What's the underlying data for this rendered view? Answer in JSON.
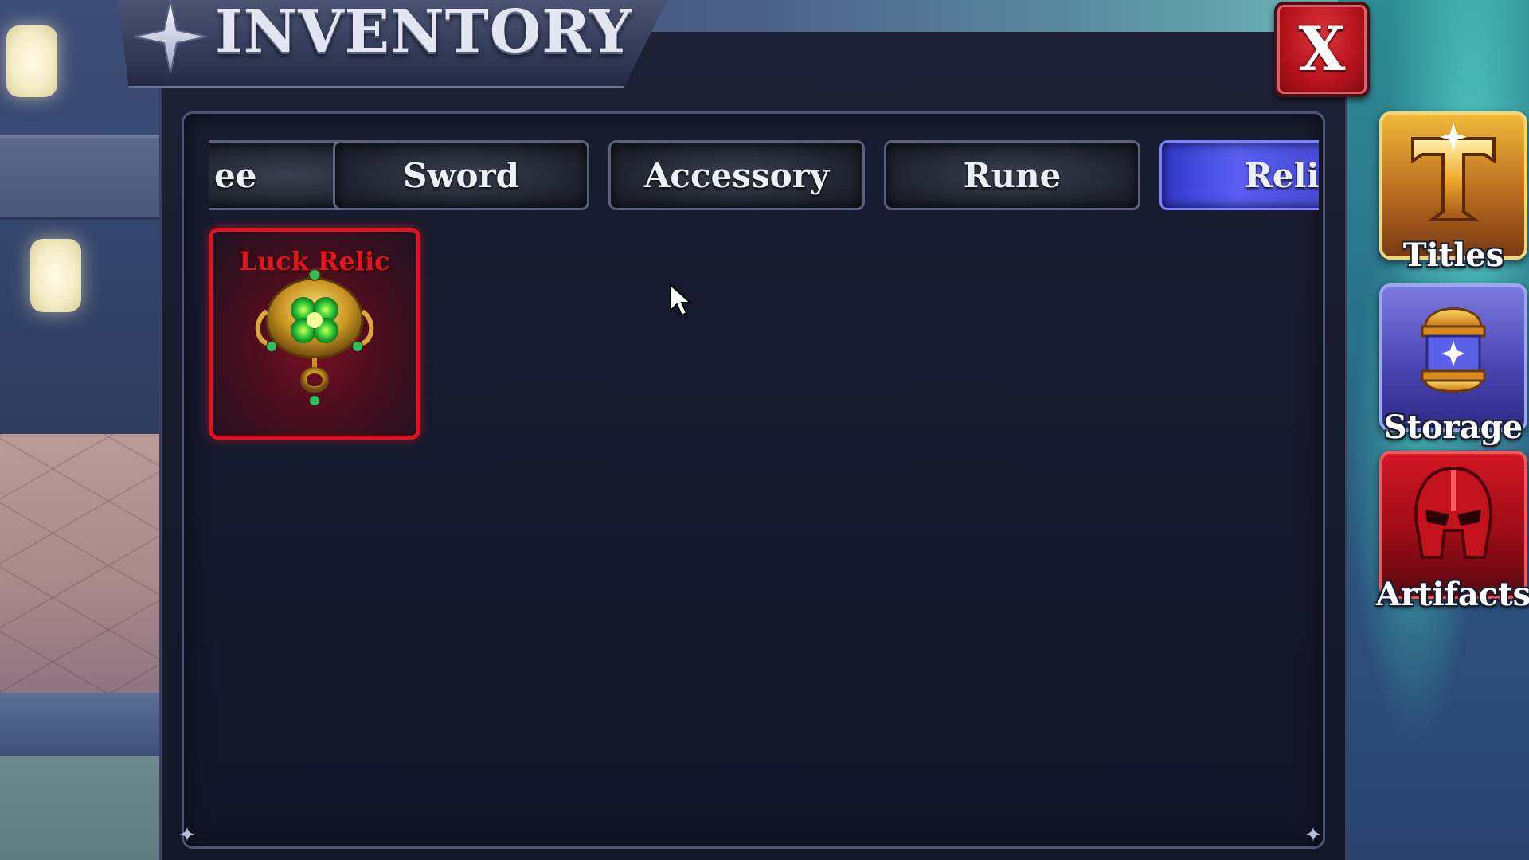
{
  "header": {
    "title": "INVENTORY",
    "close_label": "X"
  },
  "tabs": [
    {
      "label": "ee",
      "state": "partial"
    },
    {
      "label": "Sword",
      "state": "normal"
    },
    {
      "label": "Accessory",
      "state": "normal"
    },
    {
      "label": "Rune",
      "state": "normal"
    },
    {
      "label": "Relic",
      "state": "active"
    }
  ],
  "items": [
    {
      "name": "Luck Relic",
      "icon": "clover-amulet-icon",
      "rarity_color": "#e0121e"
    }
  ],
  "side_menu": [
    {
      "label": "Titles",
      "icon": "title-letter-t-icon"
    },
    {
      "label": "Storage",
      "icon": "storage-capsule-icon"
    },
    {
      "label": "Artifacts",
      "icon": "helmet-icon"
    }
  ],
  "colors": {
    "active_tab": "#5a5ef2",
    "close_button": "#b4121b",
    "panel_bg": "#161a2b"
  }
}
